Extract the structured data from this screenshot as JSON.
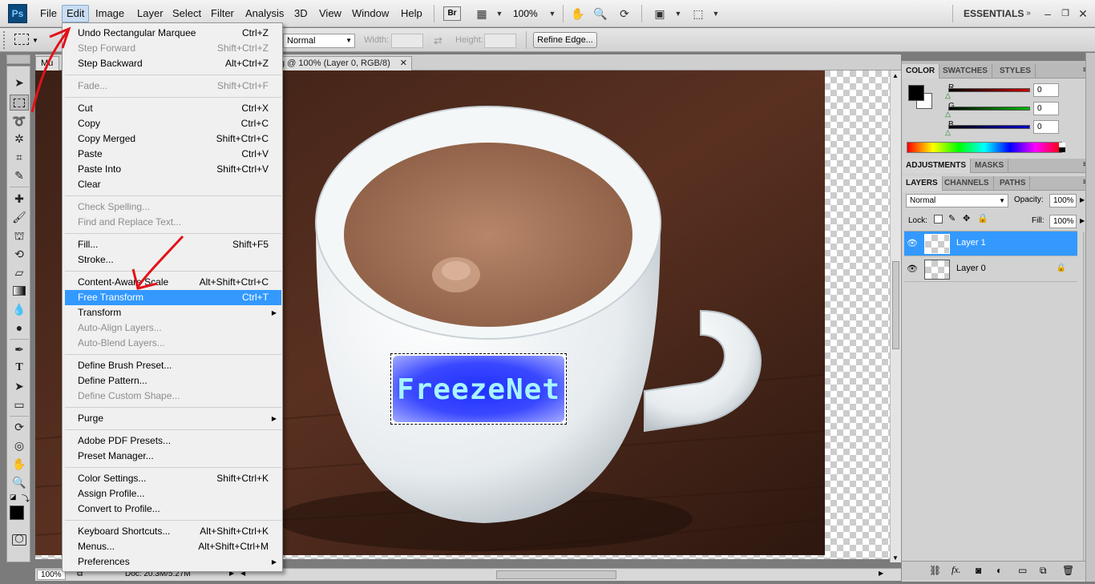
{
  "app": {
    "logo": "Ps",
    "workspace": "ESSENTIALS"
  },
  "menubar": {
    "items": [
      "File",
      "Edit",
      "Image",
      "Layer",
      "Select",
      "Filter",
      "Analysis",
      "3D",
      "View",
      "Window",
      "Help"
    ],
    "bridge": "Br",
    "zoom": "100%"
  },
  "options": {
    "style": "Normal",
    "width_label": "Width:",
    "height_label": "Height:",
    "refine_edge": "Refine Edge..."
  },
  "document": {
    "tab_short": "Mu",
    "tab_title": "g @ 100% (Layer 0, RGB/8)",
    "overlay_text": "FreezeNet",
    "status_zoom": "100%",
    "status_doc": "Doc: 20.3M/5.27M"
  },
  "edit_menu": {
    "groups": [
      [
        {
          "label": "Undo Rectangular Marquee",
          "shortcut": "Ctrl+Z",
          "enabled": true
        },
        {
          "label": "Step Forward",
          "shortcut": "Shift+Ctrl+Z",
          "enabled": false
        },
        {
          "label": "Step Backward",
          "shortcut": "Alt+Ctrl+Z",
          "enabled": true
        }
      ],
      [
        {
          "label": "Fade...",
          "shortcut": "Shift+Ctrl+F",
          "enabled": false
        }
      ],
      [
        {
          "label": "Cut",
          "shortcut": "Ctrl+X",
          "enabled": true
        },
        {
          "label": "Copy",
          "shortcut": "Ctrl+C",
          "enabled": true
        },
        {
          "label": "Copy Merged",
          "shortcut": "Shift+Ctrl+C",
          "enabled": true
        },
        {
          "label": "Paste",
          "shortcut": "Ctrl+V",
          "enabled": true
        },
        {
          "label": "Paste Into",
          "shortcut": "Shift+Ctrl+V",
          "enabled": true
        },
        {
          "label": "Clear",
          "shortcut": "",
          "enabled": true
        }
      ],
      [
        {
          "label": "Check Spelling...",
          "shortcut": "",
          "enabled": false
        },
        {
          "label": "Find and Replace Text...",
          "shortcut": "",
          "enabled": false
        }
      ],
      [
        {
          "label": "Fill...",
          "shortcut": "Shift+F5",
          "enabled": true
        },
        {
          "label": "Stroke...",
          "shortcut": "",
          "enabled": true
        }
      ],
      [
        {
          "label": "Content-Aware Scale",
          "shortcut": "Alt+Shift+Ctrl+C",
          "enabled": true
        },
        {
          "label": "Free Transform",
          "shortcut": "Ctrl+T",
          "enabled": true,
          "highlighted": true
        },
        {
          "label": "Transform",
          "shortcut": "",
          "enabled": true,
          "submenu": true
        },
        {
          "label": "Auto-Align Layers...",
          "shortcut": "",
          "enabled": false
        },
        {
          "label": "Auto-Blend Layers...",
          "shortcut": "",
          "enabled": false
        }
      ],
      [
        {
          "label": "Define Brush Preset...",
          "shortcut": "",
          "enabled": true
        },
        {
          "label": "Define Pattern...",
          "shortcut": "",
          "enabled": true
        },
        {
          "label": "Define Custom Shape...",
          "shortcut": "",
          "enabled": false
        }
      ],
      [
        {
          "label": "Purge",
          "shortcut": "",
          "enabled": true,
          "submenu": true
        }
      ],
      [
        {
          "label": "Adobe PDF Presets...",
          "shortcut": "",
          "enabled": true
        },
        {
          "label": "Preset Manager...",
          "shortcut": "",
          "enabled": true
        }
      ],
      [
        {
          "label": "Color Settings...",
          "shortcut": "Shift+Ctrl+K",
          "enabled": true
        },
        {
          "label": "Assign Profile...",
          "shortcut": "",
          "enabled": true
        },
        {
          "label": "Convert to Profile...",
          "shortcut": "",
          "enabled": true
        }
      ],
      [
        {
          "label": "Keyboard Shortcuts...",
          "shortcut": "Alt+Shift+Ctrl+K",
          "enabled": true
        },
        {
          "label": "Menus...",
          "shortcut": "Alt+Shift+Ctrl+M",
          "enabled": true
        },
        {
          "label": "Preferences",
          "shortcut": "",
          "enabled": true,
          "submenu": true
        }
      ]
    ]
  },
  "color_panel": {
    "tabs": [
      "COLOR",
      "SWATCHES",
      "STYLES"
    ],
    "channels": [
      {
        "label": "R",
        "value": "0",
        "color": "#cc0000"
      },
      {
        "label": "G",
        "value": "0",
        "color": "#00bb00"
      },
      {
        "label": "B",
        "value": "0",
        "color": "#0000cc"
      }
    ]
  },
  "adjust_panel": {
    "tabs": [
      "ADJUSTMENTS",
      "MASKS"
    ]
  },
  "layers_panel": {
    "tabs": [
      "LAYERS",
      "CHANNELS",
      "PATHS"
    ],
    "blend_mode": "Normal",
    "opacity_label": "Opacity:",
    "opacity": "100%",
    "lock_label": "Lock:",
    "fill_label": "Fill:",
    "fill": "100%",
    "layers": [
      {
        "name": "Layer 1",
        "selected": true
      },
      {
        "name": "Layer 0",
        "selected": false,
        "locked": true
      }
    ]
  },
  "colors": {
    "accent": "#3399ff",
    "selection": "#3399ff"
  }
}
